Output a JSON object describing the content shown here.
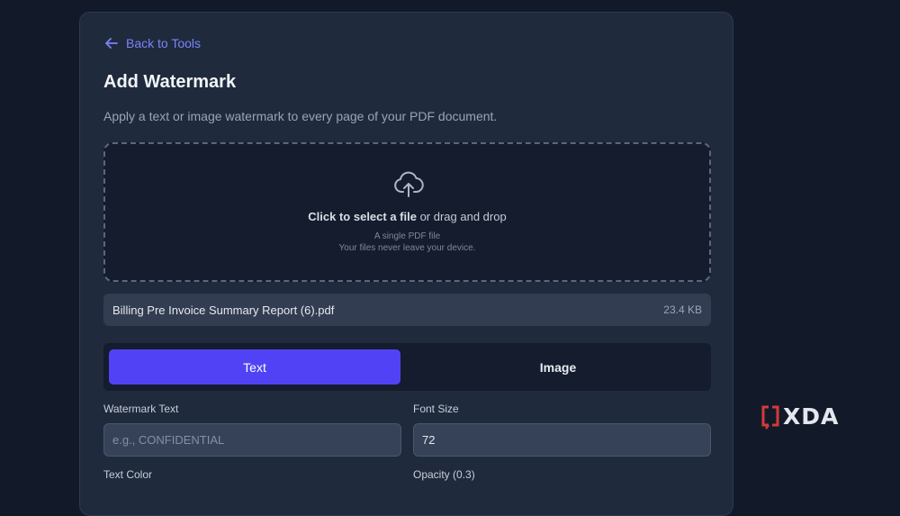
{
  "back_link": {
    "label": "Back to Tools"
  },
  "page": {
    "title": "Add Watermark",
    "subtitle": "Apply a text or image watermark to every page of your PDF document."
  },
  "dropzone": {
    "click_text": "Click to select a file",
    "drag_text": " or drag and drop",
    "hint1": "A single PDF file",
    "hint2": "Your files never leave your device."
  },
  "file": {
    "name": "Billing Pre Invoice Summary Report (6).pdf",
    "size": "23.4 KB"
  },
  "tabs": [
    {
      "label": "Text",
      "active": true
    },
    {
      "label": "Image",
      "active": false
    }
  ],
  "form": {
    "watermark_text_label": "Watermark Text",
    "watermark_text_placeholder": "e.g., CONFIDENTIAL",
    "font_size_label": "Font Size",
    "font_size_value": "72",
    "text_color_label": "Text Color",
    "opacity_label": "Opacity (0.3)"
  },
  "branding": {
    "logo_text": "XDA"
  },
  "colors": {
    "accent": "#5143f5",
    "link": "#7c83f7",
    "background": "#121a2a",
    "card": "#1f2a3d",
    "logo_bracket": "#d33a3a"
  }
}
